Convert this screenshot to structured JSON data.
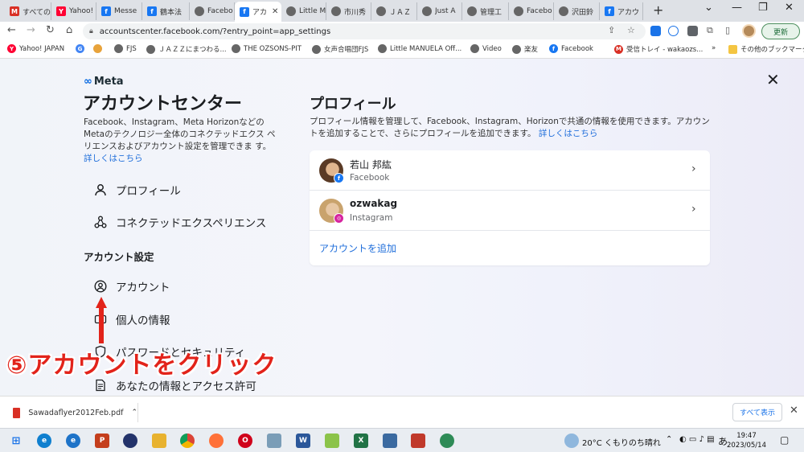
{
  "browser": {
    "tabs": [
      {
        "title": "すべての",
        "icon": "gmail-icon",
        "color": "#d93025",
        "glyph": "M"
      },
      {
        "title": "Yahoo!",
        "icon": "yahoo-icon",
        "color": "#ff0033",
        "glyph": "Y"
      },
      {
        "title": "Messe",
        "icon": "facebook-icon",
        "color": "#1877f2",
        "glyph": "f"
      },
      {
        "title": "鶴本法",
        "icon": "facebook-icon",
        "color": "#1877f2",
        "glyph": "f"
      },
      {
        "title": "Facebo",
        "icon": "globe-icon",
        "color": "#666666",
        "glyph": ""
      },
      {
        "title": "アカ",
        "icon": "facebook-icon",
        "color": "#1877f2",
        "glyph": "f",
        "active": true
      },
      {
        "title": "Little M",
        "icon": "globe-icon",
        "color": "#666666",
        "glyph": ""
      },
      {
        "title": "市川秀",
        "icon": "globe-icon",
        "color": "#666666",
        "glyph": ""
      },
      {
        "title": "ＪＡＺ",
        "icon": "globe-icon",
        "color": "#666666",
        "glyph": ""
      },
      {
        "title": "Just A",
        "icon": "globe-icon",
        "color": "#666666",
        "glyph": ""
      },
      {
        "title": "管理工",
        "icon": "globe-icon",
        "color": "#666666",
        "glyph": ""
      },
      {
        "title": "Facebo",
        "icon": "globe-icon",
        "color": "#666666",
        "glyph": ""
      },
      {
        "title": "沢田鈴",
        "icon": "globe-icon",
        "color": "#666666",
        "glyph": ""
      },
      {
        "title": "アカウ",
        "icon": "facebook-icon",
        "color": "#1877f2",
        "glyph": "f"
      }
    ],
    "url": "accountscenter.facebook.com/?entry_point=app_settings",
    "update_label": "更新",
    "bookmarks": [
      {
        "label": "Yahoo! JAPAN",
        "color": "#ff0033",
        "glyph": "Y"
      },
      {
        "label": "",
        "color": "#4285f4",
        "glyph": "G"
      },
      {
        "label": "",
        "color": "#e8a33b",
        "glyph": ""
      },
      {
        "label": "FJS",
        "color": "#666666",
        "glyph": ""
      },
      {
        "label": "ＪＡＺＺにまつわる...",
        "color": "#666666",
        "glyph": ""
      },
      {
        "label": "THE OZSONS-PIT",
        "color": "#666666",
        "glyph": ""
      },
      {
        "label": "女声合唱団FJS",
        "color": "#666666",
        "glyph": ""
      },
      {
        "label": "Little MANUELA Off...",
        "color": "#666666",
        "glyph": ""
      },
      {
        "label": "Video",
        "color": "#666666",
        "glyph": ""
      },
      {
        "label": "楽友",
        "color": "#666666",
        "glyph": ""
      },
      {
        "label": "Facebook",
        "color": "#1877f2",
        "glyph": "f"
      },
      {
        "label": "受信トレイ - wakaozs...",
        "color": "#d93025",
        "glyph": "M"
      }
    ],
    "other_bookmarks": "その他のブックマーク"
  },
  "sidebar": {
    "logo": "Meta",
    "title": "アカウントセンター",
    "description": "Facebook、Instagram、Meta Horizonなどの Metaのテクノロジー全体のコネクテッドエクス ペリエンスおよびアカウント設定を管理できま す。",
    "learn_more": "詳しくはこちら",
    "items": [
      {
        "label": "プロフィール",
        "icon": "person-icon"
      },
      {
        "label": "コネクテッドエクスペリエンス",
        "icon": "connected-icon"
      }
    ],
    "section": "アカウント設定",
    "settings_items": [
      {
        "label": "アカウント",
        "icon": "account-circle-icon"
      },
      {
        "label": "個人の情報",
        "icon": "id-card-icon"
      },
      {
        "label": "パスワードとセキュリティ",
        "icon": "shield-icon"
      },
      {
        "label": "あなたの情報とアクセス許可",
        "icon": "document-icon"
      }
    ]
  },
  "main": {
    "title": "プロフィール",
    "description": "プロフィール情報を管理して、Facebook、Instagram、Horizonで共通の情報を使用できます。アカウントを追加することで、さらにプロフィールを追加できます。",
    "learn_more": "詳しくはこちら",
    "profiles": [
      {
        "name": "若山 邦紘",
        "platform": "Facebook",
        "badge_color": "#1877f2",
        "badge_glyph": "f"
      },
      {
        "name": "ozwakag",
        "platform": "Instagram",
        "badge_color": "#d6249f",
        "badge_glyph": "◎"
      }
    ],
    "add_account": "アカウントを追加"
  },
  "annotation": {
    "text": "⑤アカウントをクリック",
    "color": "#e2231a"
  },
  "downloads": {
    "file": "Sawadaflyer2012Feb.pdf",
    "show_all": "すべて表示"
  },
  "taskbar": {
    "weather": "20°C くもりのち晴れ",
    "ime": "あ",
    "time": "19:47",
    "date": "2023/05/14"
  }
}
